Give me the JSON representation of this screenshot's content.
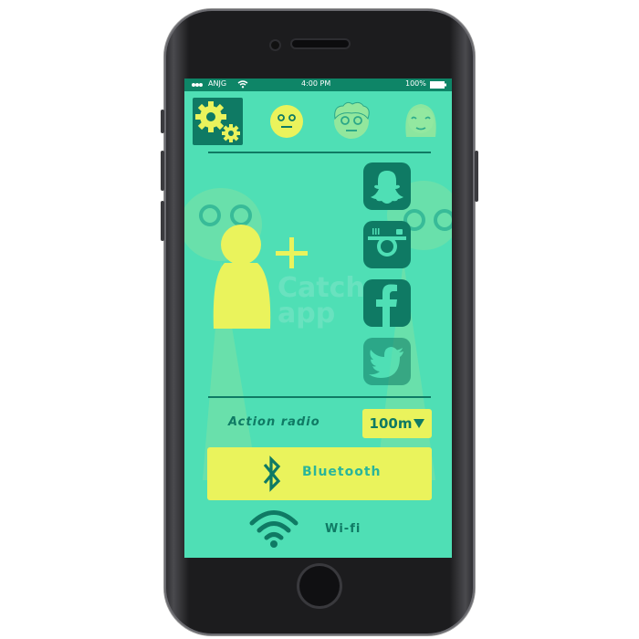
{
  "statusbar": {
    "carrier": "ANJG",
    "time": "4:00 PM",
    "battery": "100%"
  },
  "top_icons": [
    {
      "name": "settings-gears-icon"
    },
    {
      "name": "smiley-face-icon"
    },
    {
      "name": "curly-hair-face-icon"
    },
    {
      "name": "long-hair-face-icon"
    }
  ],
  "social_icons": [
    "snapchat-icon",
    "instagram-icon",
    "facebook-icon",
    "twitter-icon"
  ],
  "watermark": "Catch app",
  "action": {
    "label": "Action radio",
    "radius_value": "100m"
  },
  "bluetooth": {
    "label": "Bluetooth"
  },
  "wifi": {
    "label": "Wi-fi"
  },
  "colors": {
    "screen_bg": "#4fdfb5",
    "dark_green": "#0f7a64",
    "yellow": "#eaf35c",
    "statusbar": "#0e8567"
  }
}
